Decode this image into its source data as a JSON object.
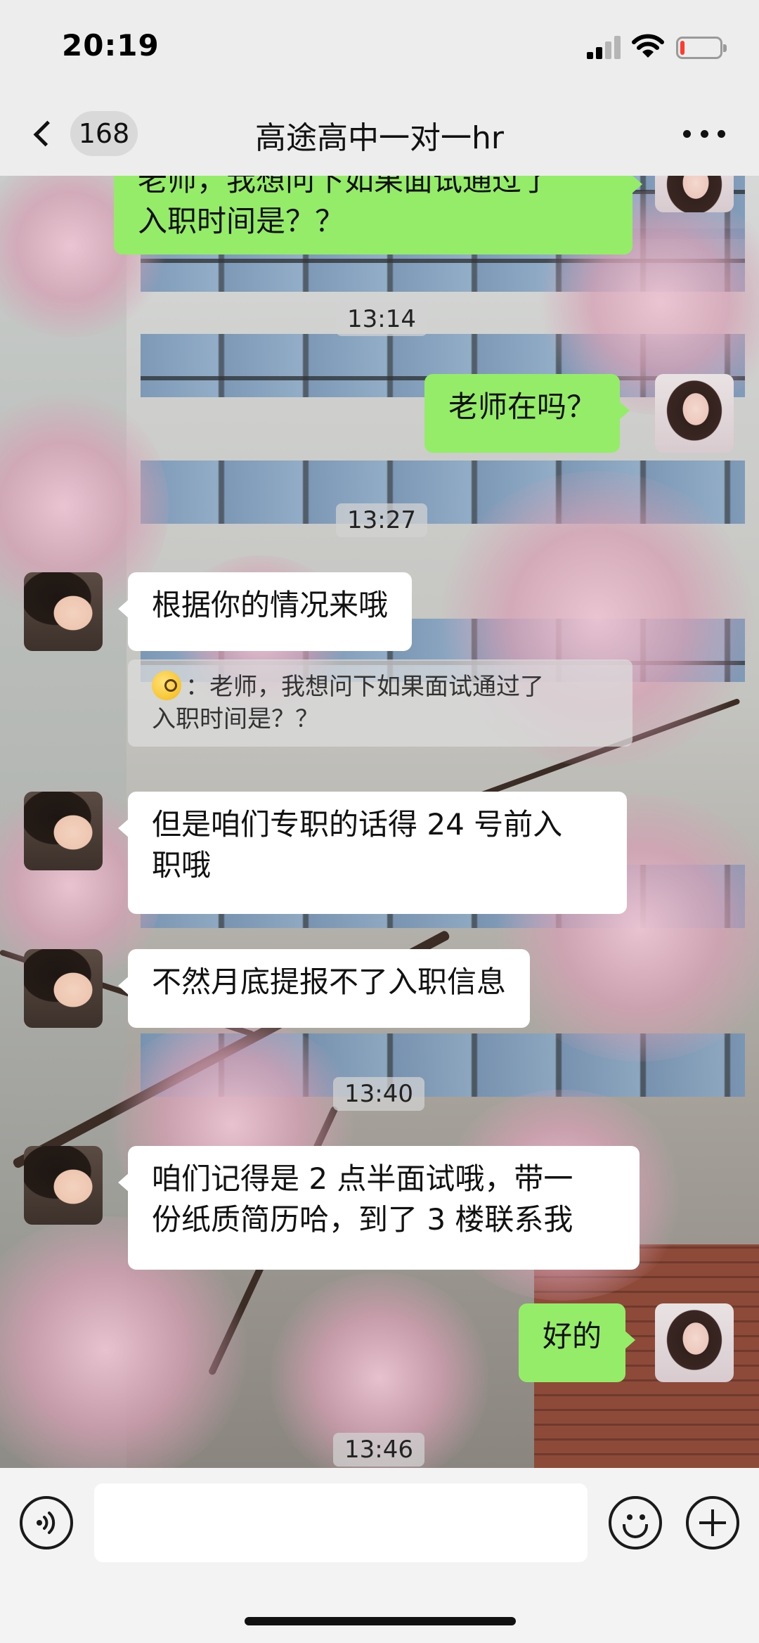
{
  "status_bar": {
    "time": "20:19",
    "battery_level": 0.12,
    "battery_color": "#ff3b30",
    "icons": [
      "signal-icon",
      "wifi-icon",
      "battery-icon"
    ]
  },
  "nav": {
    "back_icon": "chevron-left-icon",
    "unread_count": "168",
    "title": "高途高中一对一hr",
    "more_icon": "more-dots-icon"
  },
  "colors": {
    "my_bubble": "#95ec69",
    "their_bubble": "#ffffff",
    "background_bar": "#ededed"
  },
  "messages": {
    "m0": {
      "sender": "me",
      "text_line1": "老师，我想问下如果面试通过了",
      "text_line2": "入职时间是？？"
    },
    "t1": "13:14",
    "m1": {
      "sender": "me",
      "text": "老师在吗？"
    },
    "t2": "13:27",
    "m2": {
      "sender": "them",
      "text": "根据你的情况来哦"
    },
    "quote": {
      "emoji": "face-with-monocle-icon",
      "text_line1": "：老师，我想问下如果面试通过了",
      "text_line2": "入职时间是？？"
    },
    "m3": {
      "sender": "them",
      "text_line1": "但是咱们专职的话得 24 号前入",
      "text_line2": "职哦"
    },
    "m4": {
      "sender": "them",
      "text": "不然月底提报不了入职信息"
    },
    "t3": "13:40",
    "m5": {
      "sender": "them",
      "text_line1": "咱们记得是 2 点半面试哦，带一",
      "text_line2": "份纸质简历哈，到了 3 楼联系我"
    },
    "m6": {
      "sender": "me",
      "text": "好的"
    },
    "t4": "13:46"
  },
  "input_bar": {
    "voice_icon": "voice-icon",
    "emoji_icon": "emoji-icon",
    "plus_icon": "plus-icon",
    "input_value": ""
  }
}
